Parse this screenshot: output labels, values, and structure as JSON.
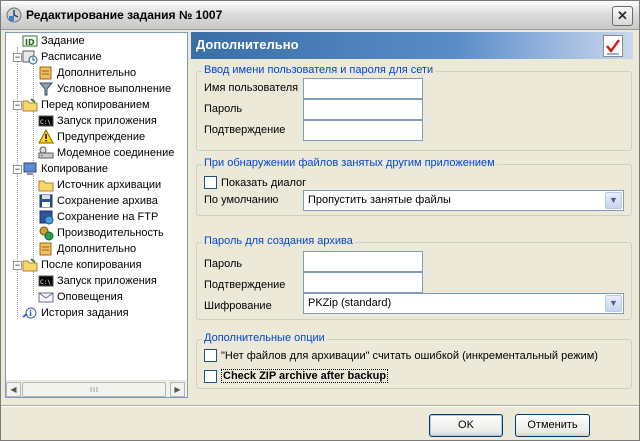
{
  "window": {
    "title": "Редактирование задания № 1007"
  },
  "tree": {
    "items": [
      {
        "label": "Задание",
        "icon": "id-card-icon"
      },
      {
        "label": "Расписание",
        "icon": "schedule-icon"
      },
      {
        "label": "Дополнительно",
        "icon": "advanced-icon"
      },
      {
        "label": "Условное выполнение",
        "icon": "filter-icon"
      },
      {
        "label": "Перед копированием",
        "icon": "folder-icon"
      },
      {
        "label": "Запуск приложения",
        "icon": "console-icon"
      },
      {
        "label": "Предупреждение",
        "icon": "warning-icon"
      },
      {
        "label": "Модемное соединение",
        "icon": "modem-icon"
      },
      {
        "label": "Копирование",
        "icon": "computer-icon"
      },
      {
        "label": "Источник архивации",
        "icon": "folder-open-icon"
      },
      {
        "label": "Сохранение архива",
        "icon": "floppy-icon"
      },
      {
        "label": "Сохранение на FTP",
        "icon": "ftp-icon"
      },
      {
        "label": "Производительность",
        "icon": "performance-icon"
      },
      {
        "label": "Дополнительно",
        "icon": "advanced-icon"
      },
      {
        "label": "После копирования",
        "icon": "folder-icon"
      },
      {
        "label": "Запуск приложения",
        "icon": "console-icon"
      },
      {
        "label": "Оповещения",
        "icon": "mail-icon"
      },
      {
        "label": "История задания",
        "icon": "history-icon"
      }
    ]
  },
  "panel": {
    "title": "Дополнительно"
  },
  "credentials": {
    "title": "Ввод имени пользователя и пароля для сети",
    "username_label": "Имя пользователя",
    "password_label": "Пароль",
    "confirm_label": "Подтверждение",
    "username_value": "",
    "password_value": "",
    "confirm_value": ""
  },
  "locked_files": {
    "title": "При обнаружении файлов занятых другим приложением",
    "show_dialog_label": "Показать диалог",
    "show_dialog_checked": false,
    "default_label": "По умолчанию",
    "default_value": "Пропустить занятые файлы"
  },
  "archive_password": {
    "title": "Пароль для создания архива",
    "password_label": "Пароль",
    "confirm_label": "Подтверждение",
    "encryption_label": "Шифрование",
    "encryption_value": "PKZip (standard)"
  },
  "extra_options": {
    "title": "Дополнительные опции",
    "no_files_error_label": "\"Нет файлов для архивации\" считать ошибкой (инкрементальный режим)",
    "no_files_error_checked": false,
    "check_zip_label": "Check ZIP archive after backup",
    "check_zip_checked": false
  },
  "buttons": {
    "ok": "OK",
    "cancel": "Отменить"
  },
  "colors": {
    "accent": "#0046d5",
    "header_start": "#3a6ea5",
    "header_end": "#c9d8ee"
  }
}
